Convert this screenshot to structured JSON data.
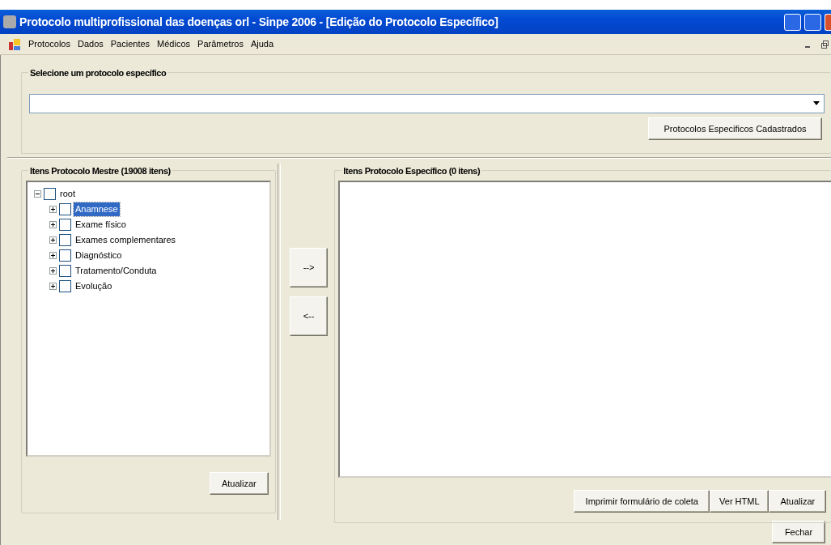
{
  "window": {
    "title": "Protocolo multiprofissional das doenças orl - Sinpe 2006 - [Edição do Protocolo Específico]"
  },
  "menu": [
    "Protocolos",
    "Dados",
    "Pacientes",
    "Médicos",
    "Parâmetros",
    "Ajuda"
  ],
  "protocol_group": {
    "title": "Selecione um protocolo específico",
    "button": "Protocolos Especificos Cadastrados"
  },
  "master_group": {
    "title": "Itens Protocolo Mestre (19008 itens)",
    "button": "Atualizar",
    "tree": [
      {
        "label": "root",
        "expanded": true,
        "checked": false,
        "selected": false,
        "children": [
          {
            "label": "Anamnese",
            "expanded": false,
            "checked": false,
            "selected": true
          },
          {
            "label": "Exame físico",
            "expanded": false,
            "checked": false,
            "selected": false
          },
          {
            "label": "Exames complementares",
            "expanded": false,
            "checked": false,
            "selected": false
          },
          {
            "label": "Diagnóstico",
            "expanded": false,
            "checked": false,
            "selected": false
          },
          {
            "label": "Tratamento/Conduta",
            "expanded": false,
            "checked": false,
            "selected": false
          },
          {
            "label": "Evolução",
            "expanded": false,
            "checked": false,
            "selected": false
          }
        ]
      }
    ]
  },
  "transfer_buttons": [
    "-->",
    "<--"
  ],
  "specific_group": {
    "title": "Itens Protocolo Específico (0 itens)",
    "buttons": [
      "Imprimir formulário de coleta",
      "Ver HTML",
      "Atualizar"
    ]
  },
  "footer": {
    "button": "Fechar"
  }
}
